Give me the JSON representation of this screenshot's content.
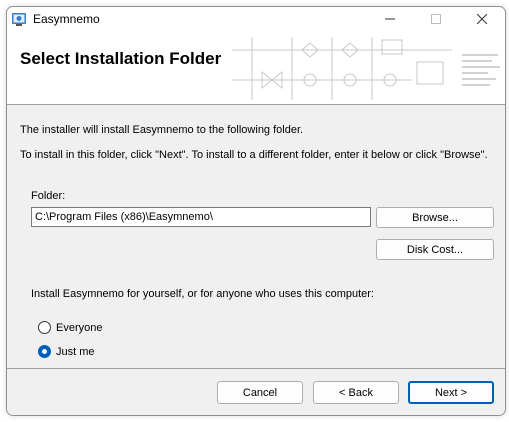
{
  "window": {
    "title": "Easymnemo",
    "icon": "installer-icon",
    "controls": [
      "minimize-icon",
      "maximize-icon",
      "close-icon"
    ]
  },
  "banner": {
    "title": "Select Installation Folder"
  },
  "body": {
    "intro_line1": "The installer will install Easymnemo to the following folder.",
    "intro_line2": "To install in this folder, click \"Next\". To install to a different folder, enter it below or click \"Browse\".",
    "folder_label": "Folder:",
    "folder_value": "C:\\Program Files (x86)\\Easymnemo\\",
    "browse_label": "Browse...",
    "disk_cost_label": "Disk Cost...",
    "install_for_text": "Install Easymnemo for yourself, or for anyone who uses this computer:",
    "radio_options": [
      {
        "label": "Everyone",
        "selected": false
      },
      {
        "label": "Just me",
        "selected": true
      }
    ]
  },
  "footer": {
    "cancel_label": "Cancel",
    "back_label": "< Back",
    "next_label": "Next >"
  },
  "colors": {
    "accent": "#005fb8",
    "dialog_bg": "#f0f0f0"
  }
}
